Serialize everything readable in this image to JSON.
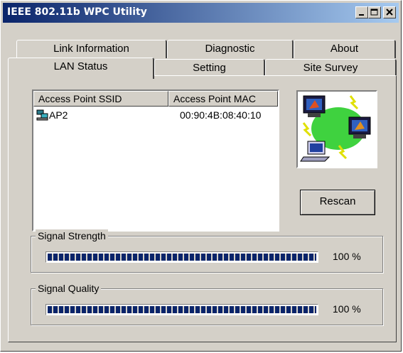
{
  "window": {
    "title": "IEEE 802.11b WPC Utility"
  },
  "tabs": {
    "row_back": [
      {
        "label": "Link Information"
      },
      {
        "label": "Diagnostic"
      },
      {
        "label": "About"
      }
    ],
    "row_front": [
      {
        "label": "LAN Status",
        "active": true
      },
      {
        "label": "Setting"
      },
      {
        "label": "Site Survey"
      }
    ]
  },
  "access_points": {
    "columns": [
      "Access Point SSID",
      "Access Point MAC"
    ],
    "rows": [
      {
        "ssid": "AP2",
        "mac": "00:90:4B:08:40:10"
      }
    ]
  },
  "buttons": {
    "rescan": "Rescan"
  },
  "signal_strength": {
    "label": "Signal Strength",
    "value": 100,
    "text": "100 %"
  },
  "signal_quality": {
    "label": "Signal Quality",
    "value": 100,
    "text": "100 %"
  },
  "colors": {
    "title_start": "#0a246a",
    "title_end": "#a6caf0",
    "progress": "#0a246a",
    "face": "#d4d0c8"
  },
  "icons": [
    "minimize-icon",
    "maximize-icon",
    "close-icon",
    "network-computer-icon",
    "wireless-network-illustration"
  ]
}
